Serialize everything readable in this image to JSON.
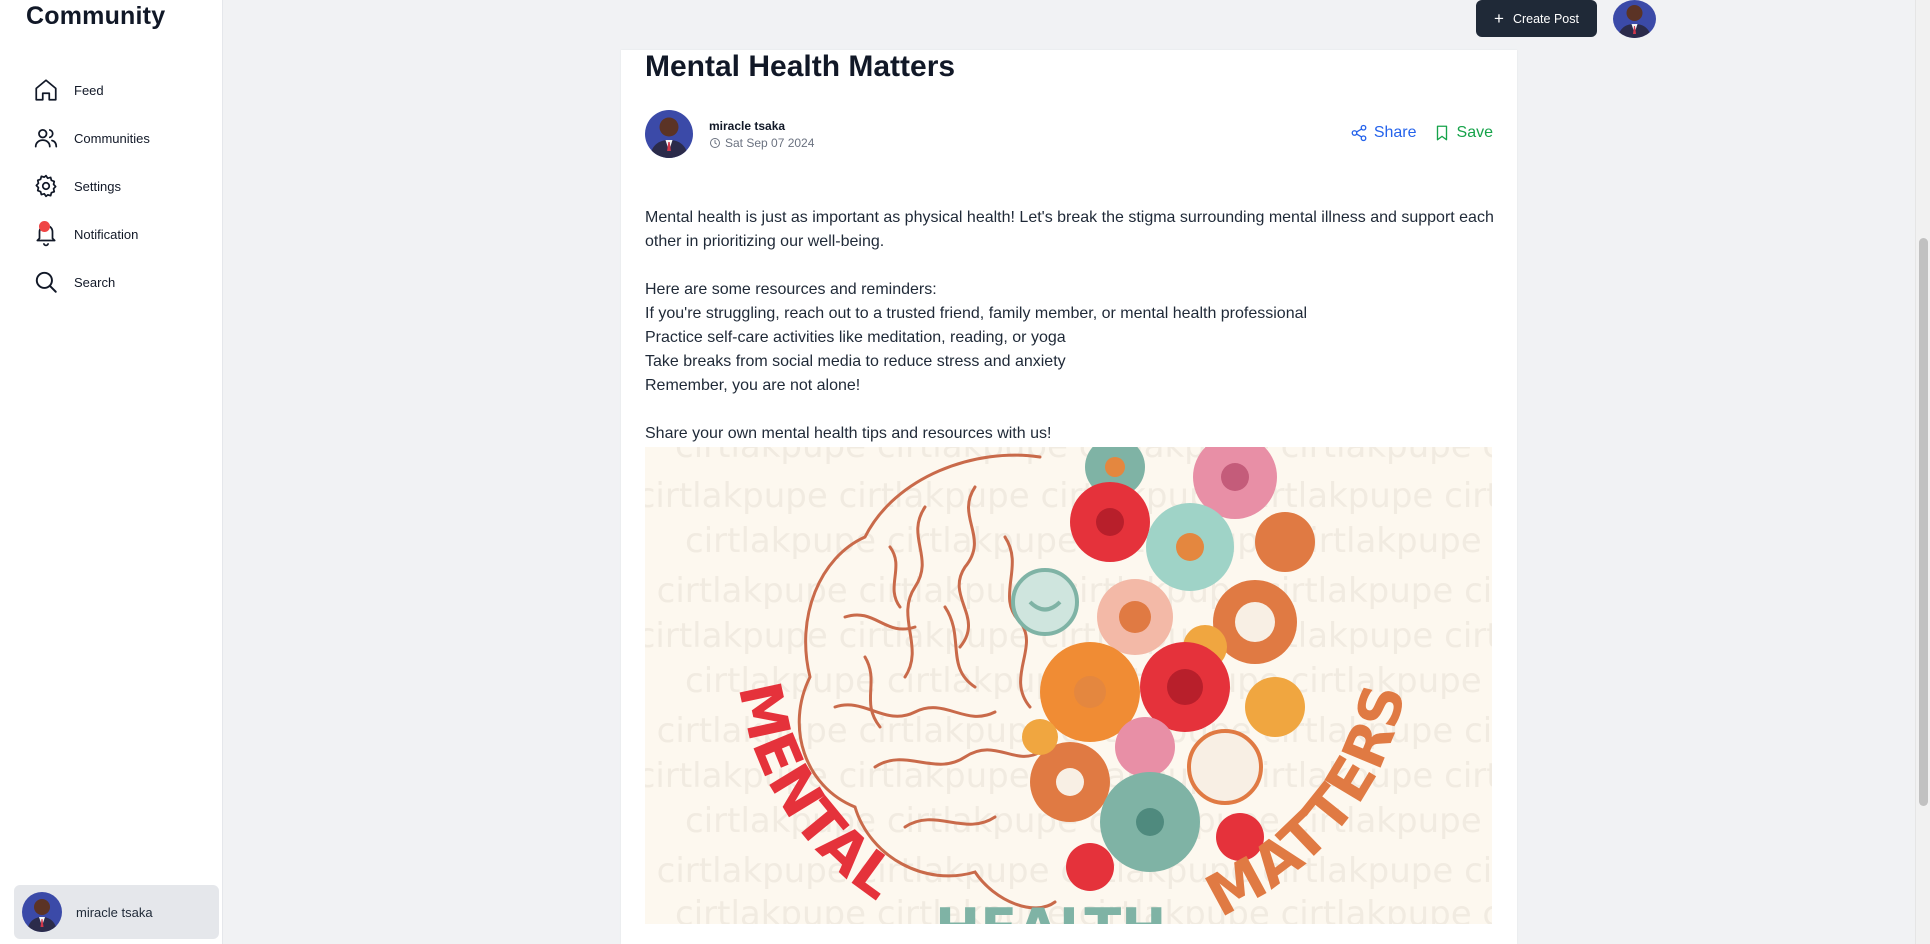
{
  "app": {
    "brand": "Community"
  },
  "sidebar": {
    "items": [
      {
        "label": "Feed",
        "icon": "home-icon"
      },
      {
        "label": "Communities",
        "icon": "users-icon"
      },
      {
        "label": "Settings",
        "icon": "gear-icon"
      },
      {
        "label": "Notification",
        "icon": "bell-icon"
      },
      {
        "label": "Search",
        "icon": "search-icon"
      }
    ],
    "profile": {
      "name": "miracle tsaka"
    }
  },
  "header": {
    "create_label": "Create Post"
  },
  "post": {
    "title": "Mental Health Matters",
    "author": "miracle tsaka",
    "date": "Sat Sep 07 2024",
    "share_label": "Share",
    "save_label": "Save",
    "body": [
      "Mental health is just as important as physical health! Let's break the stigma surrounding mental illness and support each other in prioritizing our well-being.",
      "",
      "Here are some resources and reminders:",
      "If you're struggling, reach out to a trusted friend, family member, or mental health professional",
      "Practice self-care activities like meditation, reading, or yoga",
      "Take breaks from social media to reduce stress and anxiety",
      "Remember, you are not alone!",
      "",
      "Share your own mental health tips and resources with us!"
    ],
    "image": {
      "text_left": "MENTAL",
      "text_right": "MATTERS",
      "text_bottom": "HEALTH",
      "watermark": "cirtlakpupe"
    }
  },
  "colors": {
    "accent_dark": "#1f2937",
    "share": "#2563eb",
    "save": "#16a34a",
    "notification_dot": "#ef4444",
    "image_red": "#e5323b",
    "image_orange": "#e07a43"
  }
}
